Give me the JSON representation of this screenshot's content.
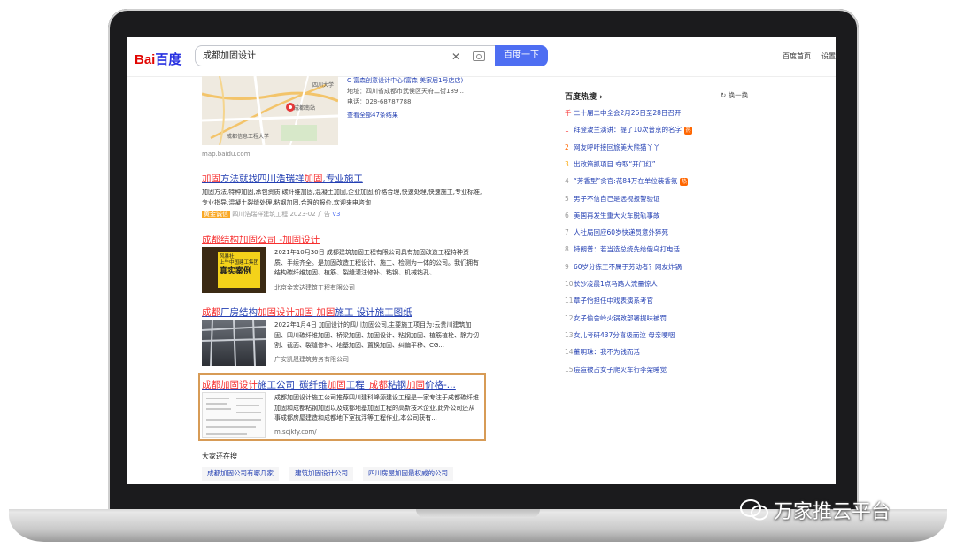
{
  "header": {
    "logo_bai": "Bai",
    "logo_du": "百度",
    "query": "成都加固设计",
    "search_button": "百度一下",
    "nav_home": "百度首页",
    "nav_settings": "设置"
  },
  "map_card": {
    "place_name": "C 富森创意设计中心(富森 美家居1号店店)",
    "address": "地址：四川省成都市武侯区天府二街189...",
    "phone": "电话：028-68787788",
    "view_all": "查看全部47条结果",
    "source": "map.baidu.com",
    "label_sichuan_univ": "四川大学",
    "label_chengdu_south": "成都南站",
    "label_school": "成都信息工程大学"
  },
  "results": [
    {
      "title_prefix": "加固",
      "title_mid": "方法就找四川浩瑞祥",
      "title_em2": "加固",
      "title_suffix": ",专业施工",
      "text": "加固方法,特种加固,承包资质,碳纤维加固,混凝土加固,企业加固,价格合理,快速处理,快速施工,专业标准,专业指导,混凝土裂缝处理,粘钢加固,合理的报价,欢迎来电咨询",
      "badge": "黄金诚信",
      "company": "四川浩瑞祥建筑工程 2023-02",
      "ad": "广告",
      "v": "V3"
    },
    {
      "title": "成都结构加固公司 -加固设计",
      "text": "2021年10月30日 成都建筑加固工程有限公司具有加固改造工程特种资质、手续齐全。是加固改造工程设计、施工、检测为一体的公司。我们拥有结构碳纤维加固、植筋、裂缝灌注修补、粘钢、机械钻孔、...",
      "source": "北京金宏达建筑工程有限公司",
      "thumb_text1": "风暴社",
      "thumb_text2": "上午中国建工集团",
      "thumb_text3": "真实案例"
    },
    {
      "title": "成都厂房结构加固设计加固 加固施工 设计施工图纸",
      "text": "2022年1月4日 加固设计的四川加固公司,主要施工项目为:云贵川建筑加固、四川碳纤维加固、桥梁加固、加固设计、粘钢加固、植筋植栓、静力切割、截面、裂缝修补、地基加固、置换加固、纠偏平移、CG...",
      "source": "广安凯晟建筑劳务有限公司"
    },
    {
      "title": "成都加固设计施工公司_碳纤维加固工程_成都粘钢加固价格-...",
      "text": "成都加固设计施工公司推荐四川建科峰源建设工程是一家专注于成都碳纤维加固和成都粘钢加固以及成都地基加固工程的高新技术企业,此外公司还从事成都房屋建造和成都地下室抗浮等工程作业,本公司获有...",
      "source": "m.scjkfy.com/"
    }
  ],
  "also_search": {
    "title": "大家还在搜",
    "items": [
      "成都加固公司有哪几家",
      "建筑加固设计公司",
      "四川房屋加固最权威的公司"
    ]
  },
  "hot_list": {
    "title": "百度热搜 ›",
    "refresh": "换一换",
    "items": [
      {
        "n": "千",
        "text": "二十届二中全会2月26日至28日召开",
        "badge": ""
      },
      {
        "n": "1",
        "text": "拜登波兰演讲：提了10次普京的名字",
        "badge": "热"
      },
      {
        "n": "2",
        "text": "网友呼吁接回旅美大熊猫丫丫",
        "badge": ""
      },
      {
        "n": "3",
        "text": "出政策抓项目 夺取“开门红”",
        "badge": ""
      },
      {
        "n": "4",
        "text": "“芳香型”贪官:花84万在单位装香氛",
        "badge": "热"
      },
      {
        "n": "5",
        "text": "男子不信自己是远视报警验证",
        "badge": ""
      },
      {
        "n": "6",
        "text": "美国再发生重大火车脱轨事故",
        "badge": ""
      },
      {
        "n": "7",
        "text": "人社局回应60岁快递员意外猝死",
        "badge": ""
      },
      {
        "n": "8",
        "text": "特朗普：若当选总统先给俄乌打电话",
        "badge": ""
      },
      {
        "n": "9",
        "text": "60岁分拣工不属于劳动者？网友炸锅",
        "badge": ""
      },
      {
        "n": "10",
        "text": "长沙凌晨1点马路人流量惊人",
        "badge": ""
      },
      {
        "n": "11",
        "text": "章子怡担任中戏表演系考官",
        "badge": ""
      },
      {
        "n": "12",
        "text": "女子偷舍岭火锅致部署提味被罚",
        "badge": ""
      },
      {
        "n": "13",
        "text": "女儿考研437分喜极而泣 母亲哽咽",
        "badge": ""
      },
      {
        "n": "14",
        "text": "董明珠：我不为钱而活",
        "badge": ""
      },
      {
        "n": "15",
        "text": "痘痘被占女子爬火车行李架睡觉",
        "badge": ""
      }
    ]
  },
  "watermark": "万家推云平台",
  "colors": {
    "brand_blue": "#4e6ef2",
    "link": "#2440b3",
    "highlight": "#f73131",
    "box": "#d79b56"
  }
}
